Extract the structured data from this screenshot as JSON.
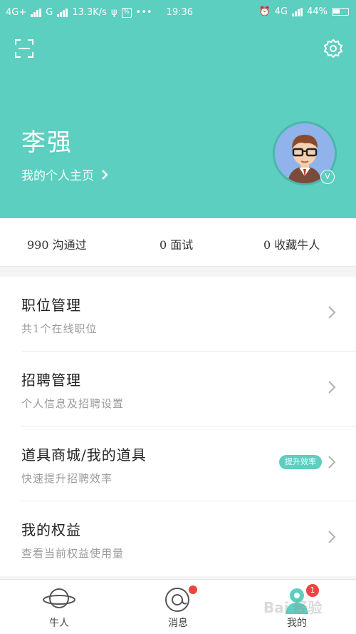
{
  "status_bar": {
    "network1": "4G+",
    "network2": "G",
    "speed": "13.3K/s",
    "more": "•••",
    "time": "19:36",
    "network3": "4G",
    "battery": "44%"
  },
  "header": {
    "user_name": "李强",
    "homepage_link": "我的个人主页",
    "verified_badge": "V",
    "bg_color": "#5ccfc0"
  },
  "stats": {
    "communicated": "990 沟通过",
    "interviews": "0 面试",
    "favorites": "0 收藏牛人"
  },
  "menu": {
    "items": [
      {
        "title": "职位管理",
        "subtitle": "共1个在线职位"
      },
      {
        "title": "招聘管理",
        "subtitle": "个人信息及招聘设置"
      },
      {
        "title": "道具商城/我的道具",
        "subtitle": "快速提升招聘效率",
        "tag": "提升效率"
      },
      {
        "title": "我的权益",
        "subtitle": "查看当前权益使用量"
      }
    ]
  },
  "tabbar": {
    "tabs": [
      {
        "label": "牛人",
        "icon": "planet-icon"
      },
      {
        "label": "消息",
        "icon": "chat-bubble-icon"
      },
      {
        "label": "我的",
        "icon": "profile-icon",
        "badge": "1"
      }
    ]
  },
  "watermark": "Bai 经验"
}
